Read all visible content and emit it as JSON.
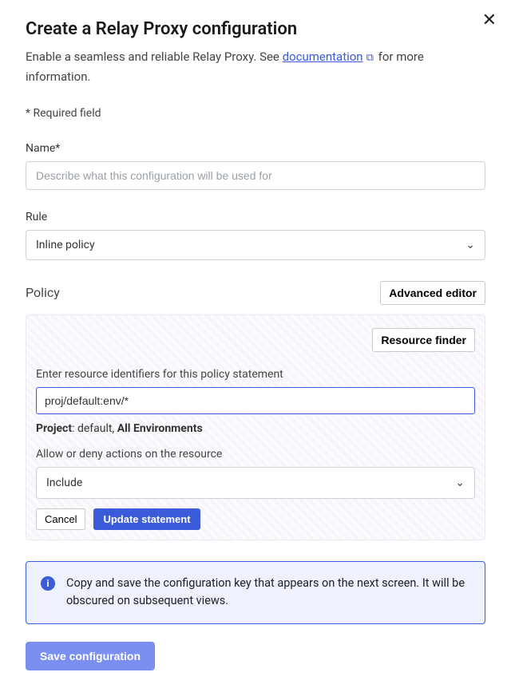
{
  "header": {
    "title": "Create a Relay Proxy configuration",
    "subtitle_before": "Enable a seamless and reliable Relay Proxy. See ",
    "doc_link_text": "documentation",
    "subtitle_after": " for more information.",
    "required_note": "* Required field"
  },
  "name": {
    "label": "Name*",
    "placeholder": "Describe what this configuration will be used for",
    "value": ""
  },
  "rule": {
    "label": "Rule",
    "selected": "Inline policy"
  },
  "policy": {
    "title": "Policy",
    "advanced_editor_label": "Advanced editor",
    "resource_finder_label": "Resource finder",
    "resource_label": "Enter resource identifiers for this policy statement",
    "resource_value": "proj/default:env/*",
    "project_prefix": "Project",
    "project_name": ": default, ",
    "all_envs": "All Environments",
    "allow_deny_label": "Allow or deny actions on the resource",
    "include_value": "Include",
    "cancel_label": "Cancel",
    "update_label": "Update statement"
  },
  "info": {
    "text": "Copy and save the configuration key that appears on the next screen. It will be obscured on subsequent views."
  },
  "footer": {
    "save_label": "Save configuration"
  }
}
